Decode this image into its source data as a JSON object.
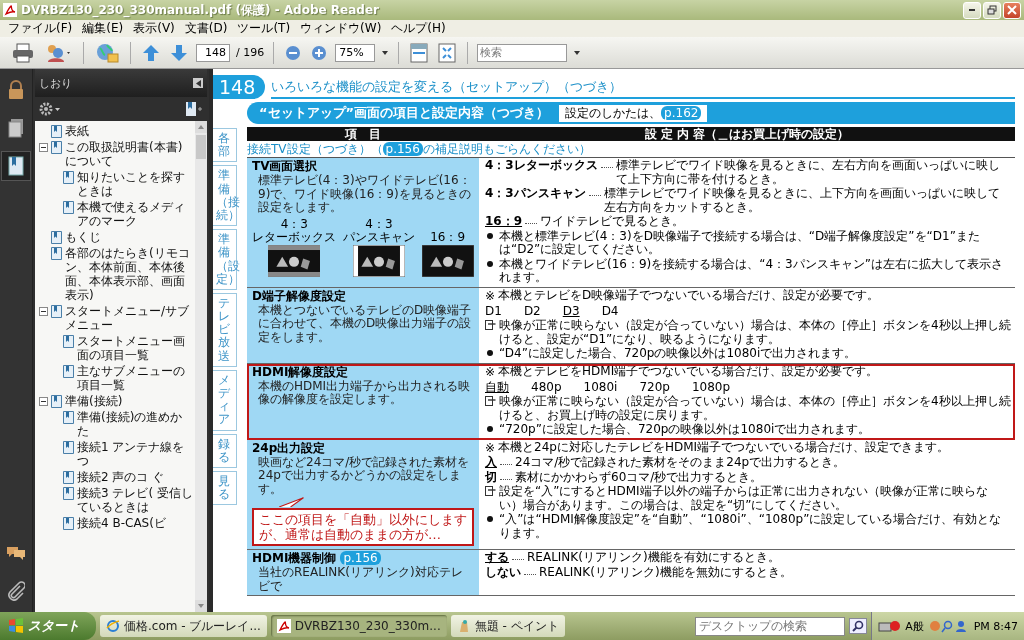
{
  "window": {
    "title": "DVRBZ130_230_330manual.pdf (保護) - Adobe Reader"
  },
  "menu": [
    "ファイル(F)",
    "編集(E)",
    "表示(V)",
    "文書(D)",
    "ツール(T)",
    "ウィンドウ(W)",
    "ヘルプ(H)"
  ],
  "toolbar": {
    "page_number": "148",
    "page_total": "/ 196",
    "zoom": "75%",
    "search": {
      "placeholder": "検索"
    }
  },
  "side_icons": [
    {
      "kind": "lock",
      "selected": false
    },
    {
      "kind": "pages",
      "selected": false
    },
    {
      "kind": "bookmarks",
      "selected": true
    }
  ],
  "bottom_icons": [
    {
      "kind": "comments"
    },
    {
      "kind": "attachments"
    }
  ],
  "bookmarks": {
    "title": "しおり",
    "items": [
      {
        "label": "表紙"
      },
      {
        "label": "この取扱説明書(本書)について",
        "expanded": true,
        "children": [
          {
            "label": "知りたいことを探すときは"
          },
          {
            "label": "本機で使えるメディアのマーク"
          }
        ]
      },
      {
        "label": "もくじ"
      },
      {
        "label": "各部のはたらき(リモコン、本体前面、本体後面、本体表示部、画面表示)"
      },
      {
        "label": "スタートメニュー/サブメニュー",
        "expanded": true,
        "children": [
          {
            "label": "スタートメニュー画面の項目一覧"
          },
          {
            "label": "主なサブメニューの項目一覧"
          }
        ]
      },
      {
        "label": "準備(接続)",
        "expanded": true,
        "children": [
          {
            "label": "準備(接続)の進めかた"
          },
          {
            "label": "接続1 アンテナ線をつ"
          },
          {
            "label": "接続2 声のコ ぐ"
          },
          {
            "label": "接続3 テレビ( 受信しているときは"
          },
          {
            "label": "接続4 B-CAS(ビ"
          }
        ]
      }
    ]
  },
  "page": {
    "number": "148",
    "title": "いろいろな機能の設定を変える（セットアップ）（つづき）",
    "section": {
      "title": "“セットアップ”画面の項目と設定内容（つづき）",
      "ref": "設定のしかたは、",
      "link": "p.162"
    },
    "side_tabs": [
      "各部",
      "準備（接続）",
      "準備（設定）",
      "テレビ放送",
      "メディア",
      "録る",
      "見る"
    ],
    "table_head": [
      "項　目",
      "設 定 内 容（＿はお買上げ時の設定）"
    ],
    "subheading": {
      "before": "接続TV設定（つづき）（",
      "link": "p.156",
      "after": "の補足説明もごらんください）"
    },
    "rows": [
      {
        "title": "TV画面選択",
        "highlighted": false,
        "desc": "標準テレビ(4：3)やワイドテレビ(16：9)で、ワイド映像(16：9)を見るときの設定をします。",
        "thumbs": [
          {
            "kind": "letterbox",
            "ratio": "4：3",
            "label": "レターボックス"
          },
          {
            "kind": "panscan",
            "ratio": "4：3",
            "label": "パンスキャン"
          },
          {
            "kind": "wide",
            "ratio": "16：9"
          }
        ],
        "blocks": [
          {
            "kind": "options",
            "items": [
              {
                "label": "4：3レターボックス",
                "default": false,
                "desc": "標準テレビでワイド映像を見るときに、左右方向を画面いっぱいに映して上下方向に帯を付けるとき。"
              },
              {
                "label": "4：3パンスキャン",
                "default": false,
                "desc": "標準テレビでワイド映像を見るときに、上下方向を画面いっぱいに映して左右方向をカットするとき。"
              },
              {
                "label": "16：9",
                "default": true,
                "desc": "ワイドテレビで見るとき。"
              }
            ]
          },
          {
            "kind": "bullet",
            "text": "本機と標準テレビ(4：3)をD映像端子で接続する場合は、“D端子解像度設定”を“D1”または“D2”に設定してください。"
          },
          {
            "kind": "bullet",
            "text": "本機とワイドテレビ(16：9)を接続する場合は、“4：3パンスキャン”は左右に拡大して表示されます。"
          }
        ]
      },
      {
        "title": "D端子解像度設定",
        "highlighted": false,
        "desc": "本機とつないでいるテレビのD映像端子に合わせて、本機のD映像出力端子の設定をします。",
        "blocks": [
          {
            "kind": "note",
            "mark": "※",
            "text": "本機とテレビをD映像端子でつないでいる場合だけ、設定が必要です。"
          },
          {
            "kind": "choices",
            "items": [
              {
                "label": "D1",
                "default": false
              },
              {
                "label": "D2",
                "default": false
              },
              {
                "label": "D3",
                "default": true
              },
              {
                "label": "D4",
                "default": false
              }
            ]
          },
          {
            "kind": "tip",
            "text": "映像が正常に映らない（設定が合っていない）場合は、本体の［停止］ボタンを4秒以上押し続けると、設定が“D1”になり、映るようになります。"
          },
          {
            "kind": "bullet",
            "text": "“D4”に設定した場合、720pの映像以外は1080iで出力されます。"
          }
        ]
      },
      {
        "title": "HDMI解像度設定",
        "highlighted": true,
        "desc": "本機のHDMI出力端子から出力される映像の解像度を設定します。",
        "blocks": [
          {
            "kind": "note",
            "mark": "※",
            "text": "本機とテレビをHDMI端子でつないでいる場合だけ、設定が必要です。"
          },
          {
            "kind": "choices",
            "items": [
              {
                "label": "自動",
                "default": true
              },
              {
                "label": "480p",
                "default": false
              },
              {
                "label": "1080i",
                "default": false
              },
              {
                "label": "720p",
                "default": false
              },
              {
                "label": "1080p",
                "default": false
              }
            ]
          },
          {
            "kind": "tip",
            "text": "映像が正常に映らない（設定が合っていない）場合は、本体の［停止］ボタンを4秒以上押し続けると、お買上げ時の設定に戻ります。"
          },
          {
            "kind": "bullet",
            "text": "“720p”に設定した場合、720pの映像以外は1080iで出力されます。"
          }
        ]
      },
      {
        "title": "24p出力設定",
        "highlighted": false,
        "desc": "映画など24コマ/秒で記録された素材を24pで出力するかどうかの設定をします。",
        "blocks": [
          {
            "kind": "note",
            "mark": "※",
            "text": "本機と24pに対応したテレビをHDMI端子でつないでいる場合だけ、設定できます。"
          },
          {
            "kind": "options",
            "items": [
              {
                "label": "入",
                "default": true,
                "desc": "24コマ/秒で記録された素材をそのまま24pで出力するとき。"
              },
              {
                "label": "切",
                "default": false,
                "desc": "素材にかかわらず60コマ/秒で出力するとき。"
              }
            ]
          },
          {
            "kind": "tip",
            "text": "設定を“入”にするとHDMI端子以外の端子からは正常に出力されない（映像が正常に映らない）場合があります。この場合は、設定を“切”にしてください。"
          },
          {
            "kind": "bullet",
            "text": "“入”は“HDMI解像度設定”を“自動”、“1080i”、“1080p”に設定している場合だけ、有効となります。"
          }
        ]
      },
      {
        "title": "HDMI機器制御",
        "link": "p.156",
        "highlighted": false,
        "desc": "当社のREALINK(リアリンク)対応テレビで",
        "blocks": [
          {
            "kind": "options",
            "items": [
              {
                "label": "する",
                "default": true,
                "desc": "REALINK(リアリンク)機能を有効にするとき。"
              },
              {
                "label": "しない",
                "default": false,
                "desc": "REALINK(リアリンク)機能を無効にするとき。"
              }
            ]
          }
        ]
      }
    ]
  },
  "callout": {
    "text": "ここの項目を「自動」以外にしますが、通常は自動のままの方が…"
  },
  "taskbar": {
    "start": "スタート",
    "tasks": [
      {
        "kind": "browser",
        "label": "価格.com - ブルーレイ...",
        "selected": false
      },
      {
        "kind": "pdf",
        "label": "DVRBZ130_230_330m...",
        "selected": true
      },
      {
        "kind": "paint",
        "label": "無題 - ペイント",
        "selected": false
      }
    ],
    "search": {
      "placeholder": "デスクトップの検索"
    },
    "ime": "A般",
    "clock": "PM 8:47"
  }
}
